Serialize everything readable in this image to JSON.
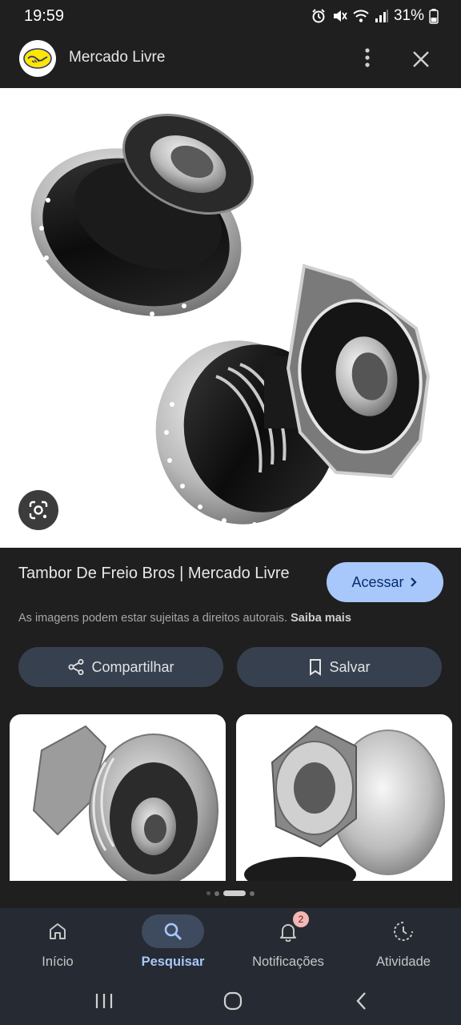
{
  "status_bar": {
    "time": "19:59",
    "battery": "31%"
  },
  "app_bar": {
    "site_name": "Mercado Livre"
  },
  "result": {
    "title": "Tambor De Freio Bros | Mercado Livre",
    "visit_label": "Acessar",
    "copyright_notice": "As imagens podem estar sujeitas a direitos autorais.",
    "learn_more": "Saiba mais"
  },
  "actions": {
    "share_label": "Compartilhar",
    "save_label": "Salvar"
  },
  "bottom_nav": {
    "items": [
      {
        "label": "Início",
        "icon": "home-icon",
        "active": false
      },
      {
        "label": "Pesquisar",
        "icon": "search-icon",
        "active": true
      },
      {
        "label": "Notificações",
        "icon": "bell-icon",
        "active": false,
        "badge": "2"
      },
      {
        "label": "Atividade",
        "icon": "activity-icon",
        "active": false
      }
    ]
  },
  "colors": {
    "accent": "#a8c7fa",
    "background": "#1f1f1f",
    "pill": "#36404f",
    "nav_background": "#262b33"
  }
}
